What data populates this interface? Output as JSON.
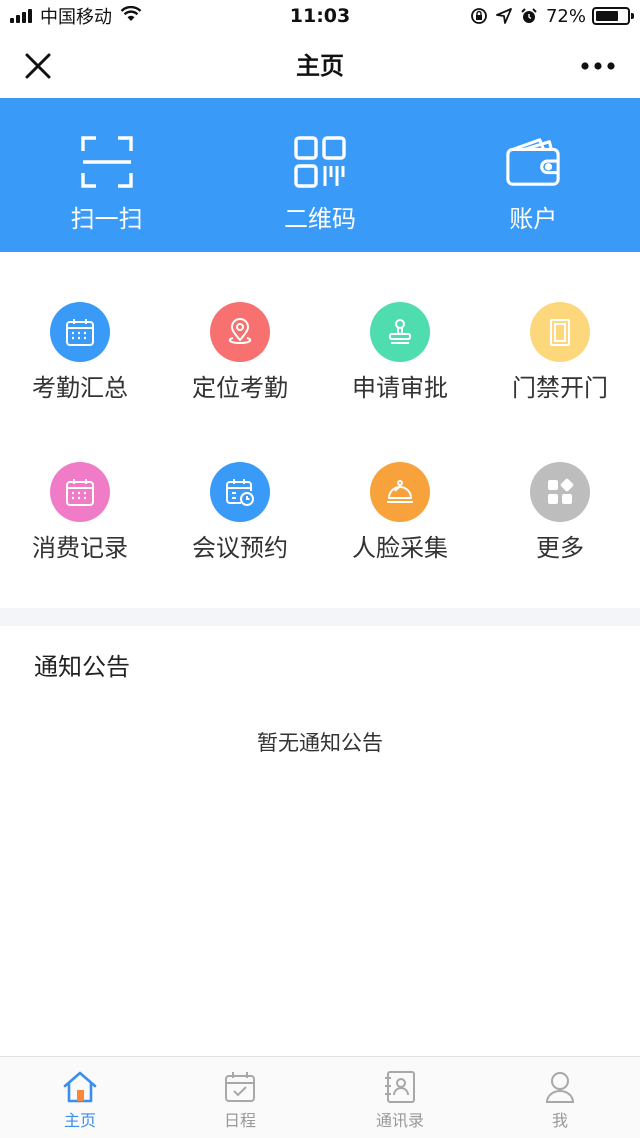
{
  "status_bar": {
    "carrier": "中国移动",
    "time": "11:03",
    "battery": "72%",
    "battery_level": 0.72
  },
  "nav": {
    "title": "主页",
    "close_icon": "close-icon",
    "more_icon": "more-icon"
  },
  "quick_actions": [
    {
      "label": "扫一扫",
      "icon": "scan-icon"
    },
    {
      "label": "二维码",
      "icon": "qr-code-icon"
    },
    {
      "label": "账户",
      "icon": "wallet-icon"
    }
  ],
  "grid": [
    {
      "label": "考勤汇总",
      "icon": "calendar-icon",
      "color": "#3a9af8"
    },
    {
      "label": "定位考勤",
      "icon": "location-icon",
      "color": "#f87171"
    },
    {
      "label": "申请审批",
      "icon": "stamp-icon",
      "color": "#4fdcae"
    },
    {
      "label": "门禁开门",
      "icon": "door-icon",
      "color": "#fdd77c"
    },
    {
      "label": "消费记录",
      "icon": "calendar-icon",
      "color": "#f07cc7"
    },
    {
      "label": "会议预约",
      "icon": "calendar-clock-icon",
      "color": "#3a9af8"
    },
    {
      "label": "人脸采集",
      "icon": "bell-icon",
      "color": "#f7a23a"
    },
    {
      "label": "更多",
      "icon": "apps-icon",
      "color": "#bdbdbd"
    }
  ],
  "notice": {
    "title": "通知公告",
    "empty_text": "暂无通知公告"
  },
  "tabs": [
    {
      "label": "主页",
      "icon": "home-icon",
      "active": true
    },
    {
      "label": "日程",
      "icon": "calendar-check-icon",
      "active": false
    },
    {
      "label": "通讯录",
      "icon": "contacts-icon",
      "active": false
    },
    {
      "label": "我",
      "icon": "user-icon",
      "active": false
    }
  ],
  "colors": {
    "brand_blue": "#3a9af8",
    "tab_active": "#3a8ef0",
    "tab_inactive": "#999999"
  }
}
